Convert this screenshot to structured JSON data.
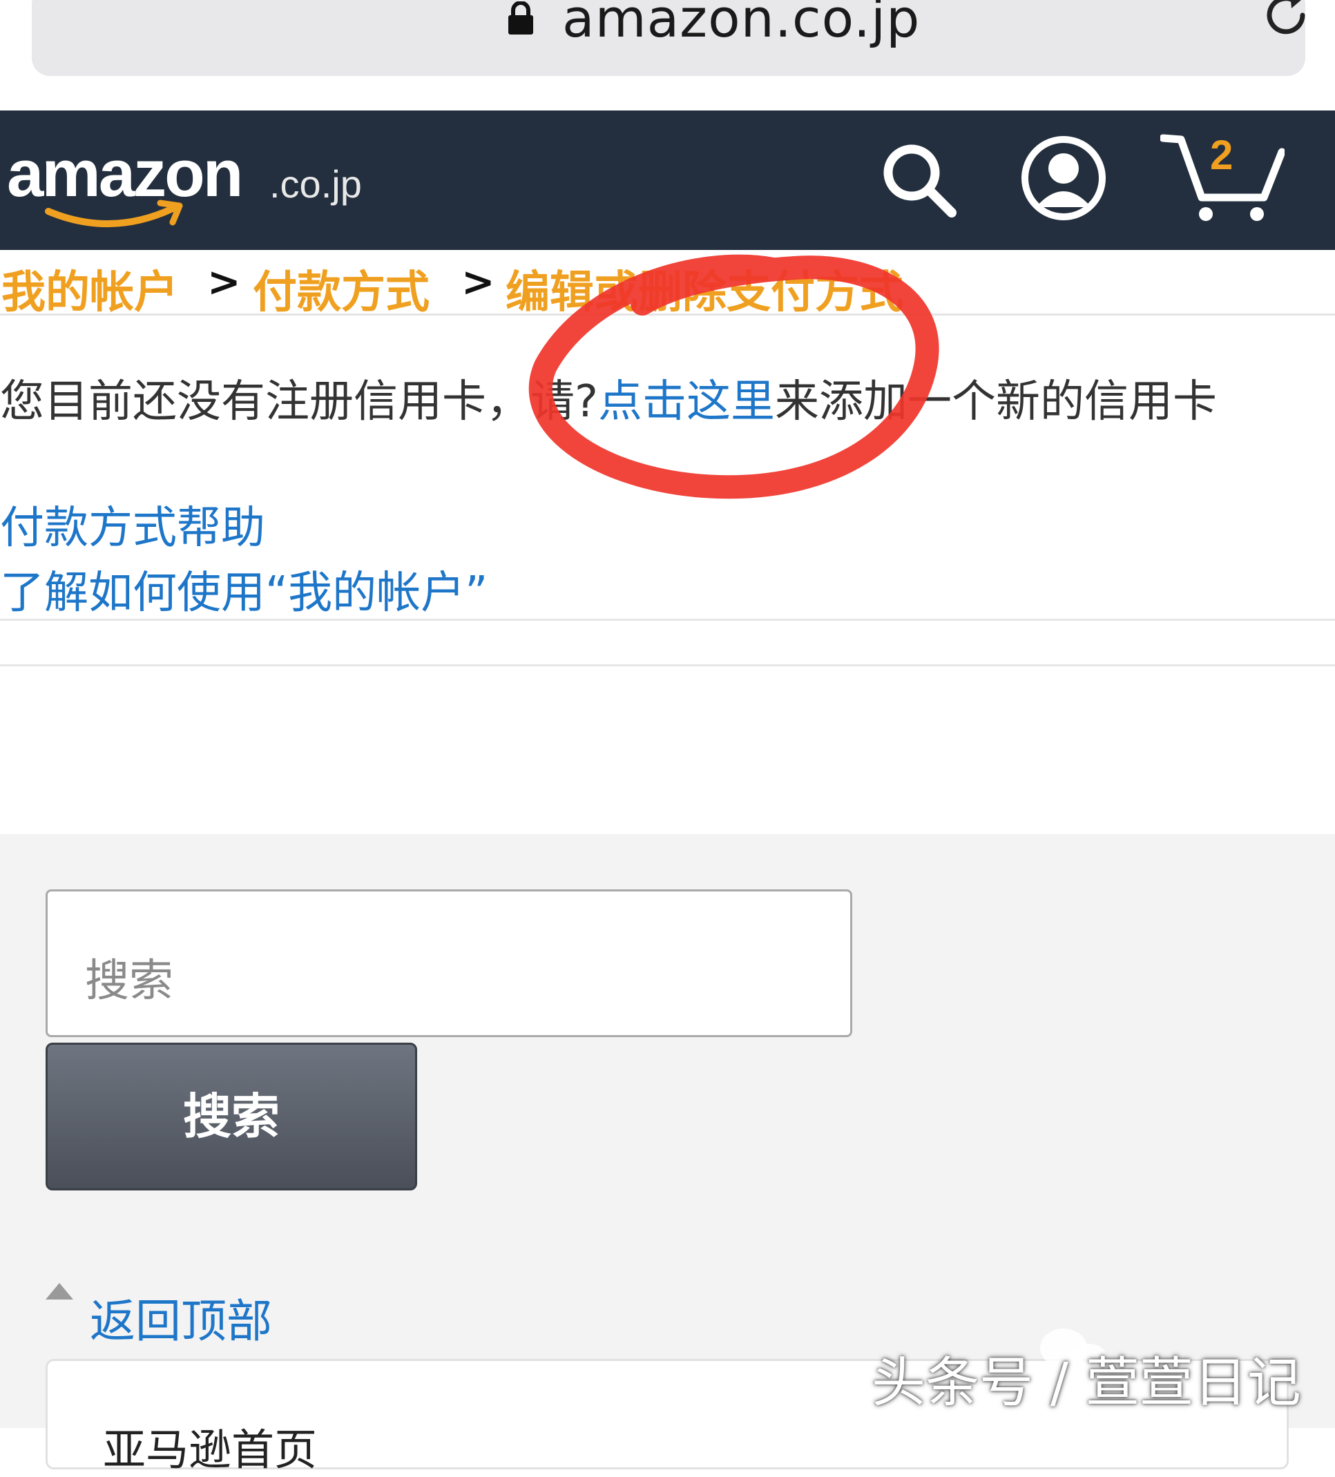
{
  "browser": {
    "url": "amazon.co.jp"
  },
  "header": {
    "logo_text": "amazon",
    "logo_suffix": ".co.jp",
    "cart_count": "2"
  },
  "breadcrumb": {
    "items": [
      "我的帐户",
      "付款方式",
      "编辑或删除支付方式"
    ],
    "separator": ">"
  },
  "message": {
    "prefix": "您目前还没有注册信用卡，请?",
    "link": "点击这里",
    "suffix": "来添加一个新的信用卡"
  },
  "help_links": [
    "付款方式帮助",
    "了解如何使用“我的帐户”"
  ],
  "footer": {
    "search_placeholder": "搜索",
    "search_button": "搜索",
    "back_to_top": "返回顶部",
    "home_link": "亚马逊首页"
  },
  "watermark": {
    "text": "头条号 / 萱萱日记"
  },
  "colors": {
    "header_bg": "#232f3e",
    "breadcrumb_orange": "#f0a020",
    "link_blue": "#1e76c9",
    "annotation_red": "#f0342a"
  }
}
